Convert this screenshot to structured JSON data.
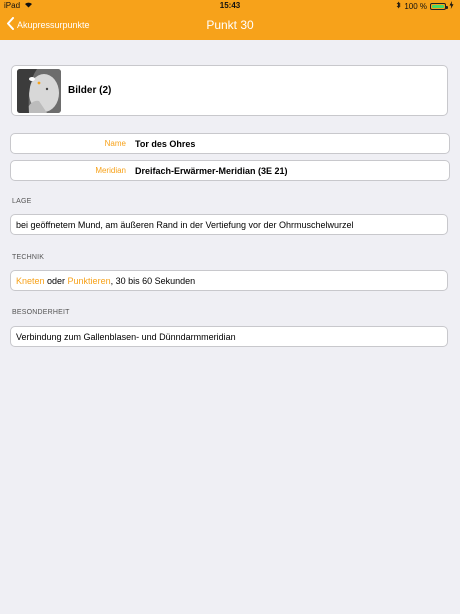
{
  "status": {
    "device": "iPad",
    "time": "15:43",
    "battery": "100 %"
  },
  "nav": {
    "back_label": "Akupressurpunkte",
    "title": "Punkt 30"
  },
  "images": {
    "label": "Bilder (2)"
  },
  "fields": [
    {
      "label": "Name",
      "value": "Tor des Ohres"
    },
    {
      "label": "Meridian",
      "value": "Dreifach-Erwärmer-Meridian (3E 21)"
    }
  ],
  "sections": {
    "lage": {
      "heading": "LAGE",
      "text": "bei geöffnetem Mund, am äußeren Rand in der Vertiefung vor der Ohrmuschelwurzel"
    },
    "technik": {
      "heading": "TECHNIK",
      "link1": "Kneten",
      "conj": " oder ",
      "link2": "Punktieren",
      "rest": ", 30 bis 60 Sekunden"
    },
    "besonderheit": {
      "heading": "BESONDERHEIT",
      "text": "Verbindung zum Gallenblasen- und Dünndarmmeridian"
    }
  },
  "colors": {
    "accent": "#f7a21a",
    "background": "#efeff4",
    "battery": "#4cd964"
  }
}
